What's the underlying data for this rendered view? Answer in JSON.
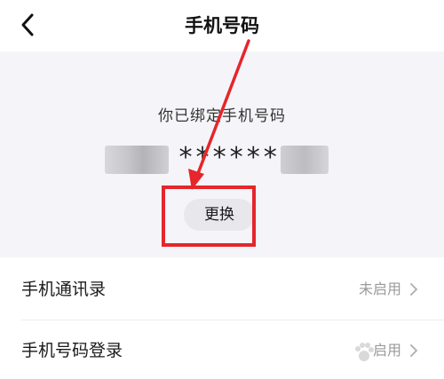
{
  "header": {
    "title": "手机号码",
    "back_icon": "back-arrow-icon"
  },
  "binding": {
    "label": "你已绑定手机号码",
    "masked_number": "******",
    "change_label": "更换"
  },
  "settings": [
    {
      "label": "手机通讯录",
      "value": "未启用"
    },
    {
      "label": "手机号码登录",
      "value": "启用"
    }
  ],
  "colors": {
    "panel_bg": "#f5f5f9",
    "annotation_red": "#e5262b",
    "muted_text": "#9a9a9a"
  }
}
